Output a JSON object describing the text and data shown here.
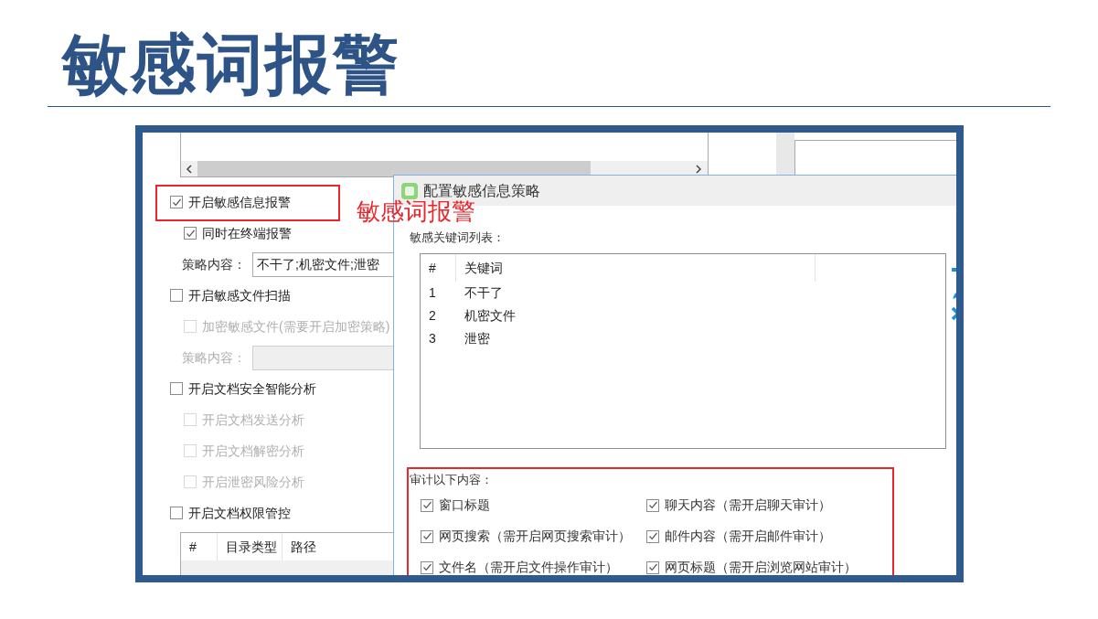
{
  "slide": {
    "title": "敏感词报警"
  },
  "window": {
    "options": [
      {
        "kind": "checkbox",
        "label": "开启敏感信息报警",
        "checked": true,
        "disabled": false,
        "highlighted": true,
        "children": [
          {
            "kind": "checkbox",
            "label": "同时在终端报警",
            "checked": true,
            "disabled": false
          },
          {
            "kind": "field",
            "label": "策略内容：",
            "value": "不干了;机密文件;泄密",
            "disabled": false
          }
        ]
      },
      {
        "kind": "checkbox",
        "label": "开启敏感文件扫描",
        "checked": false,
        "disabled": false,
        "highlighted": false,
        "children": [
          {
            "kind": "checkbox",
            "label": "加密敏感文件(需要开启加密策略)",
            "checked": false,
            "disabled": true
          },
          {
            "kind": "field",
            "label": "策略内容：",
            "disabled": true
          }
        ]
      },
      {
        "kind": "checkbox",
        "label": "开启文档安全智能分析",
        "checked": false,
        "disabled": false,
        "highlighted": false,
        "children": [
          {
            "kind": "checkbox",
            "label": "开启文档发送分析",
            "checked": false,
            "disabled": true
          },
          {
            "kind": "checkbox",
            "label": "开启文档解密分析",
            "checked": false,
            "disabled": true
          },
          {
            "kind": "checkbox",
            "label": "开启泄密风险分析",
            "checked": false,
            "disabled": true
          }
        ]
      },
      {
        "kind": "checkbox",
        "label": "开启文档权限管控",
        "checked": false,
        "disabled": false,
        "highlighted": false
      }
    ],
    "permission_table": {
      "columns": [
        "#",
        "目录类型",
        "路径"
      ]
    }
  },
  "annotation": {
    "text": "敏感词报警"
  },
  "dialog": {
    "title": "配置敏感信息策略",
    "keyword_list": {
      "label": "敏感关键词列表：",
      "columns": [
        "#",
        "关键词"
      ],
      "rows": [
        [
          "1",
          "不干了"
        ],
        [
          "2",
          "机密文件"
        ],
        [
          "3",
          "泄密"
        ]
      ]
    },
    "audit": {
      "label": "审计以下内容：",
      "highlighted": true,
      "items": [
        {
          "label": "窗口标题",
          "checked": true
        },
        {
          "label": "聊天内容（需开启聊天审计）",
          "checked": true
        },
        {
          "label": "网页搜索（需开启网页搜索审计）",
          "checked": true
        },
        {
          "label": "邮件内容（需开启邮件审计）",
          "checked": true
        },
        {
          "label": "文件名（需开启文件操作审计）",
          "checked": true
        },
        {
          "label": "网页标题（需开启浏览网站审计）",
          "checked": true
        }
      ]
    }
  }
}
